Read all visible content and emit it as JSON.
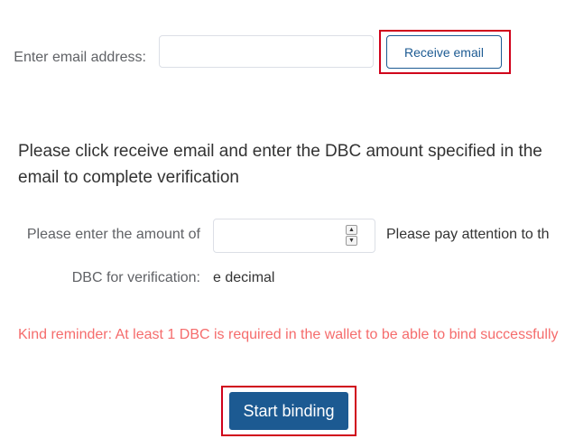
{
  "email_row": {
    "label": "Enter email address:",
    "input_value": "",
    "receive_button_label": "Receive email"
  },
  "instruction_text": "Please click receive email and enter the DBC amount specified in the email to complete verification",
  "amount_row": {
    "label": "Please enter the amount of DBC for verification:",
    "input_value": "",
    "spin_up": "▲",
    "spin_down": "▼",
    "note_part1": "Please pay attention to th",
    "note_part2": "e decimal"
  },
  "reminder_text": "Kind reminder: At least 1 DBC is required in the wallet to be able to bind successfully",
  "start_button_label": "Start binding",
  "colors": {
    "primary": "#1c5a92",
    "highlight": "#d0021b",
    "reminder": "#f56c6c"
  }
}
